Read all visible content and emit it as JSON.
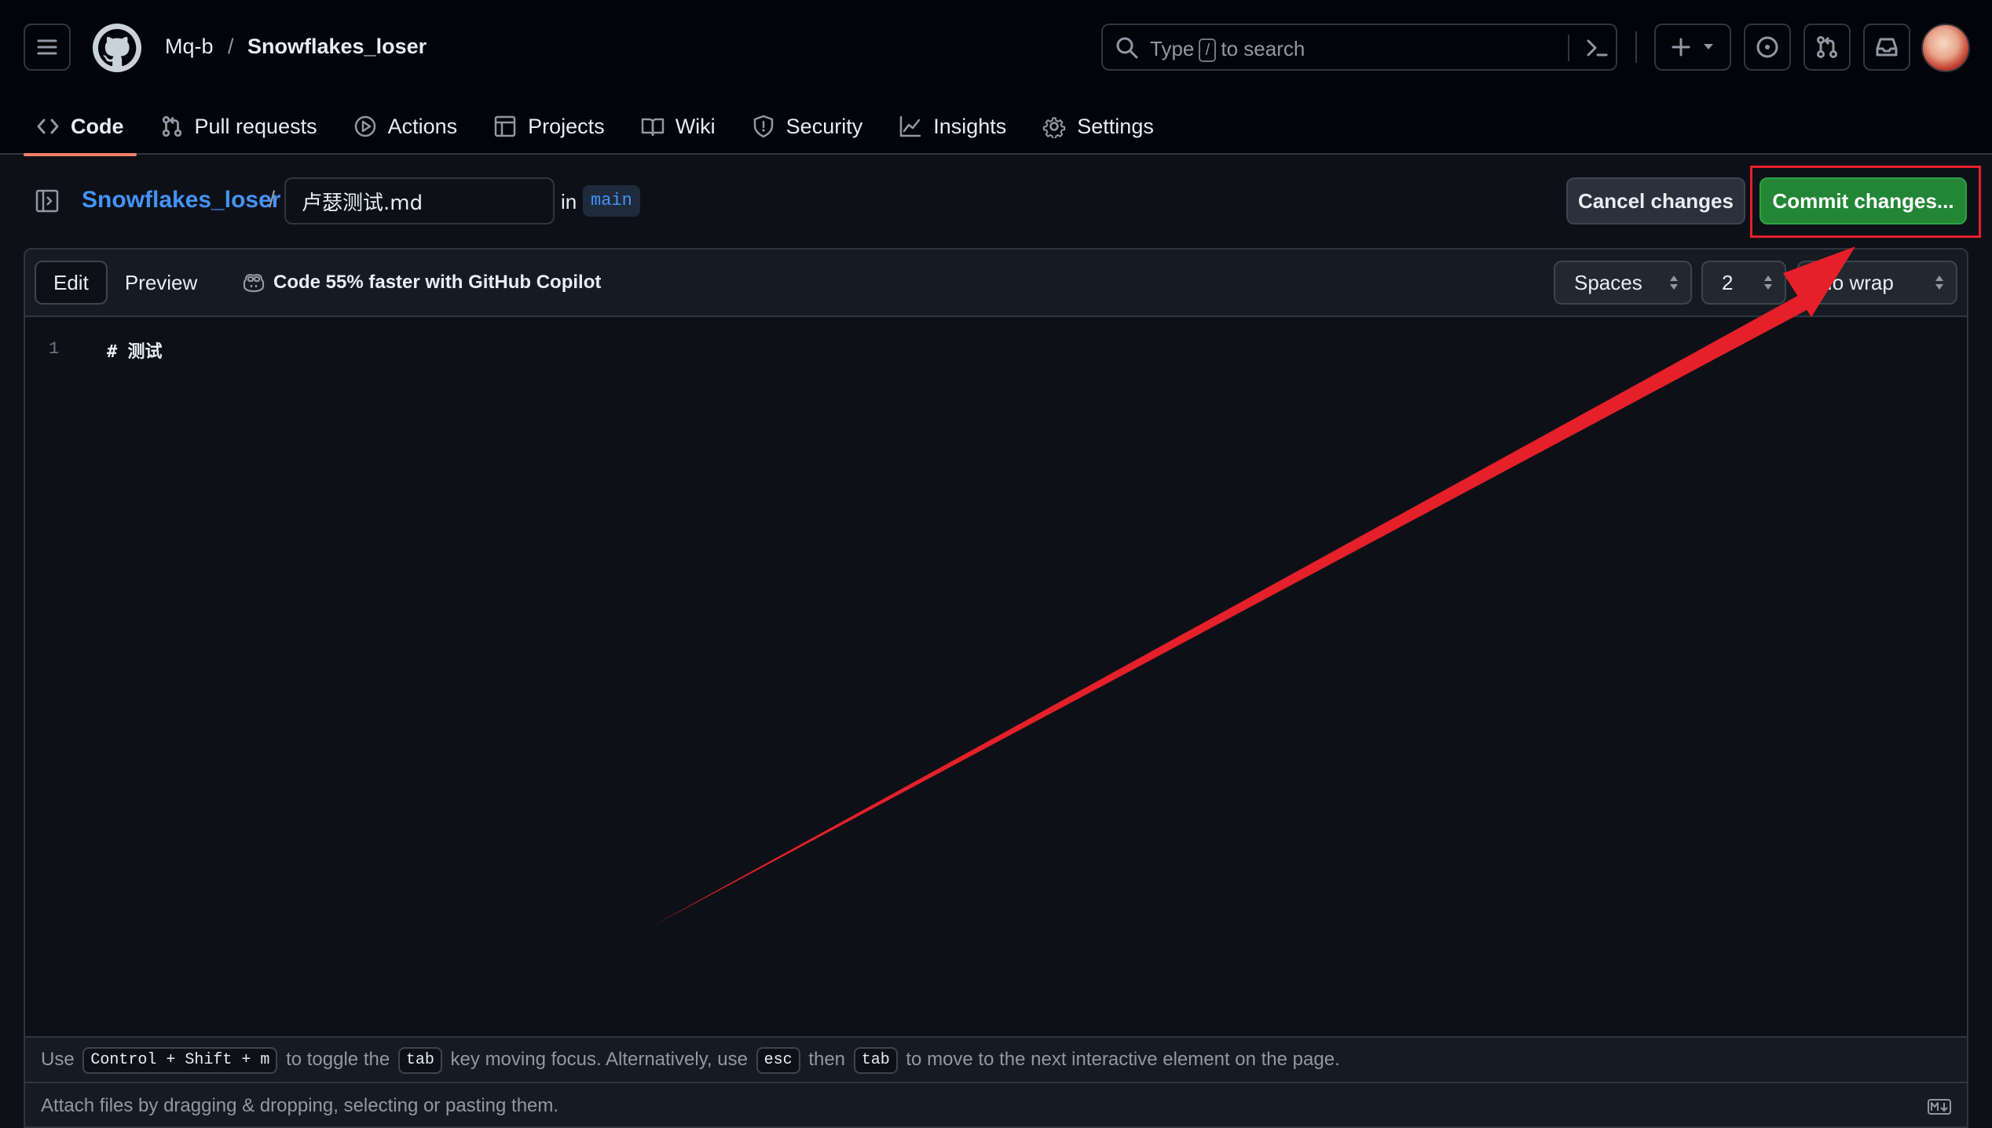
{
  "header": {
    "owner": "Mq-b",
    "separator": "/",
    "repo": "Snowflakes_loser",
    "search": {
      "prefix": "Type",
      "slash": "/",
      "suffix": "to search"
    }
  },
  "tabs": [
    {
      "label": "Code",
      "icon": "code-icon",
      "active": true
    },
    {
      "label": "Pull requests",
      "icon": "git-pull-request-icon"
    },
    {
      "label": "Actions",
      "icon": "play-icon"
    },
    {
      "label": "Projects",
      "icon": "table-icon"
    },
    {
      "label": "Wiki",
      "icon": "book-icon"
    },
    {
      "label": "Security",
      "icon": "shield-icon"
    },
    {
      "label": "Insights",
      "icon": "graph-icon"
    },
    {
      "label": "Settings",
      "icon": "gear-icon"
    }
  ],
  "editbar": {
    "repo_link": "Snowflakes_loser",
    "path_sep": "/",
    "filename": "卢瑟测试.md",
    "in_label": "in",
    "branch": "main",
    "cancel_label": "Cancel changes",
    "commit_label": "Commit changes..."
  },
  "editor": {
    "edit_tab": "Edit",
    "preview_tab": "Preview",
    "copilot_text": "Code 55% faster with GitHub Copilot",
    "indent_mode": "Spaces",
    "indent_size": "2",
    "wrap_mode": "No wrap",
    "lines": [
      {
        "number": "1",
        "text": "# 测试"
      }
    ]
  },
  "footer": {
    "use": "Use",
    "shortcut": "Control + Shift + m",
    "toggle_text": "to toggle the",
    "tab_key": "tab",
    "moving_text": "key moving focus. Alternatively, use",
    "esc_key": "esc",
    "then_text": "then",
    "tab_key2": "tab",
    "end_text": "to move to the next interactive element on the page.",
    "attach_text": "Attach files by dragging & dropping, selecting or pasting them."
  },
  "colors": {
    "accent_blue": "#4493f8",
    "commit_green": "#238636",
    "annotation_red": "#e5202b",
    "active_tab_underline": "#f78166"
  }
}
